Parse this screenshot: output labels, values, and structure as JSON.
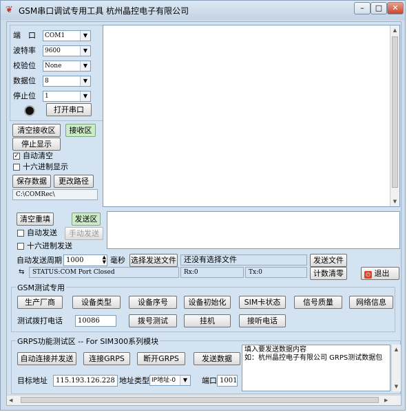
{
  "window": {
    "title": "GSM串口调试专用工具 杭州晶控电子有限公司",
    "minimize": "–",
    "maximize": "□",
    "close": "✕"
  },
  "serial": {
    "port_label": "端　口",
    "port_value": "COM1",
    "baud_label": "波特率",
    "baud_value": "9600",
    "parity_label": "校验位",
    "parity_value": "None",
    "databits_label": "数据位",
    "databits_value": "8",
    "stopbits_label": "停止位",
    "stopbits_value": "1",
    "open_button": "打开串口"
  },
  "receive": {
    "clear_button": "清空接收区",
    "area_label": "接收区",
    "stop_display_button": "停止显示",
    "auto_clear_label": "自动清空",
    "auto_clear_checked": "✓",
    "hex_display_label": "十六进制显示",
    "save_button": "保存数据",
    "change_path_button": "更改路径",
    "path": "C:\\COMRec\\"
  },
  "send": {
    "clear_resend_button": "清空重填",
    "area_label": "发送区",
    "auto_send_label": "自动发送",
    "manual_send_button": "手动发送",
    "hex_send_label": "十六进制发送",
    "period_label": "自动发送周期",
    "period_value": "1000",
    "ms_label": "毫秒",
    "choose_file_button": "选择发送文件",
    "file_status": "还没有选择文件",
    "send_file_button": "发送文件",
    "reset_count_button": "计数清零",
    "exit_button": "退出"
  },
  "status": {
    "port_status": "STATUS:COM Port Closed",
    "rx": "Rx:0",
    "tx": "Tx:0"
  },
  "gsm": {
    "group_title": "GSM测试专用",
    "buttons": [
      "生产厂商",
      "设备类型",
      "设备序号",
      "设备初始化",
      "SIM卡状态",
      "信号质量",
      "网络信息"
    ],
    "dial_label": "测试拨打电话",
    "dial_value": "10086",
    "dial_button": "拨号测试",
    "hangup_button": "挂机",
    "answer_button": "接听电话"
  },
  "gprs": {
    "group_title": "GRPS功能测试区 -- For SIM300系列模块",
    "auto_connect_button": "自动连接并发送",
    "connect_button": "连接GRPS",
    "disconnect_button": "断开GRPS",
    "send_button": "发送数据",
    "target_label": "目标地址",
    "target_value": "115.193.126.228",
    "addr_type_label": "地址类型",
    "addr_type_value": "IP地址-0",
    "port_label": "端口",
    "port_value": "1001",
    "data_line1": "填入要发送数据内容",
    "data_line2": "如：杭州晶控电子有限公司  GRPS测试数据包"
  }
}
